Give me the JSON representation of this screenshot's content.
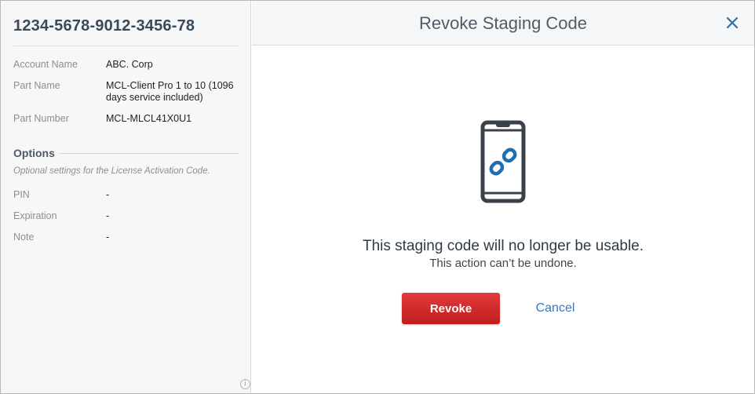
{
  "left_panel": {
    "code_title": "1234-5678-9012-3456-78",
    "fields": [
      {
        "label": "Account Name",
        "value": "ABC. Corp"
      },
      {
        "label": "Part Name",
        "value": "MCL-Client Pro  1 to 10 (1096 days service included)"
      },
      {
        "label": "Part Number",
        "value": "MCL-MLCL41X0U1"
      }
    ],
    "options": {
      "title": "Options",
      "description": "Optional settings for the License Activation Code.",
      "fields": [
        {
          "label": "PIN",
          "value": "-"
        },
        {
          "label": "Expiration",
          "value": "-"
        },
        {
          "label": "Note",
          "value": "-"
        }
      ]
    },
    "info_icon_glyph": "i"
  },
  "dialog": {
    "title": "Revoke Staging Code",
    "close_icon": "close-icon",
    "illustration_icon": "phone-broken-link-icon",
    "message": "This staging code will no longer be usable.",
    "sub_message": "This action can’t be undone.",
    "revoke_label": "Revoke",
    "cancel_label": "Cancel"
  },
  "colors": {
    "title_text": "#3b4a58",
    "revoke_button": "#d42a2a",
    "cancel_link": "#3a79b8",
    "link_icon": "#1f6fb0",
    "phone_outline": "#3b4148"
  }
}
